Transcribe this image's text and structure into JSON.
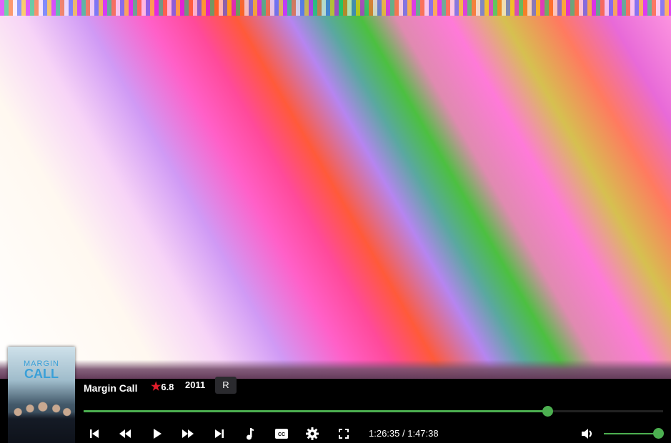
{
  "movie": {
    "title": "Margin Call",
    "poster_text_line1": "MARGIN",
    "poster_text_line2": "CALL",
    "rating": "6.8",
    "year": "2011",
    "mpaa": "R"
  },
  "playback": {
    "current_time": "1:26:35",
    "separator": " / ",
    "duration": "1:47:38",
    "progress_fraction": 0.8,
    "volume_fraction": 1.0
  },
  "colors": {
    "accent": "#4caf50",
    "star": "#e21d2a"
  },
  "controls": [
    "skip-previous-icon",
    "rewind-icon",
    "play-icon",
    "fast-forward-icon",
    "skip-next-icon",
    "music-note-icon",
    "closed-captions-icon",
    "gear-icon",
    "fullscreen-icon",
    "volume-icon"
  ]
}
